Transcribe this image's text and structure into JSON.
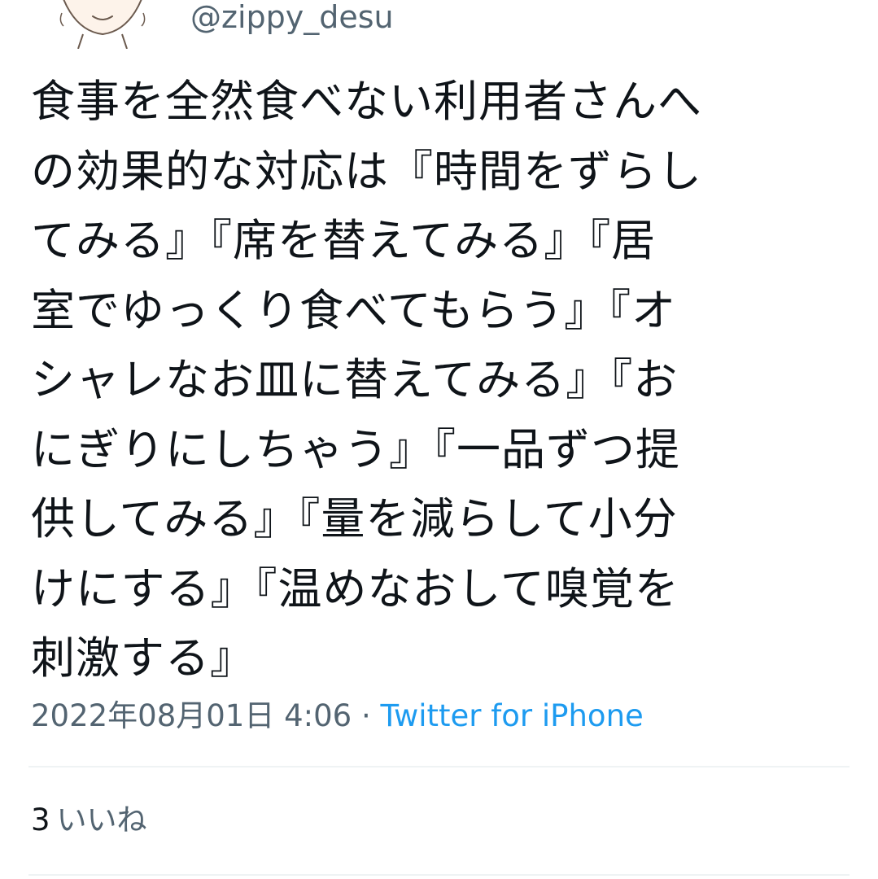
{
  "author": {
    "handle": "@zippy_desu",
    "avatar_icon": "illustrated-face-avatar"
  },
  "tweet": {
    "lines": [
      "食事を全然食べない利用者さんへ",
      "の効果的な対応は『時間をずらし",
      "てみる』『席を替えてみる』『居",
      "室でゆっくり食べてもらう』『オ",
      "シャレなお皿に替えてみる』『お",
      "にぎりにしちゃう』『一品ずつ提",
      "供してみる』『量を減らして小分",
      "けにする』『温めなおして嗅覚を",
      "刺激する』"
    ],
    "timestamp": "2022年08月01日 4:06",
    "separator": " · ",
    "source": "Twitter for iPhone"
  },
  "stats": {
    "likes_count": "3",
    "likes_label": "いいね"
  },
  "colors": {
    "text": "#0f1419",
    "secondary": "#536471",
    "link": "#1d9bf0",
    "divider": "#eff3f4"
  }
}
